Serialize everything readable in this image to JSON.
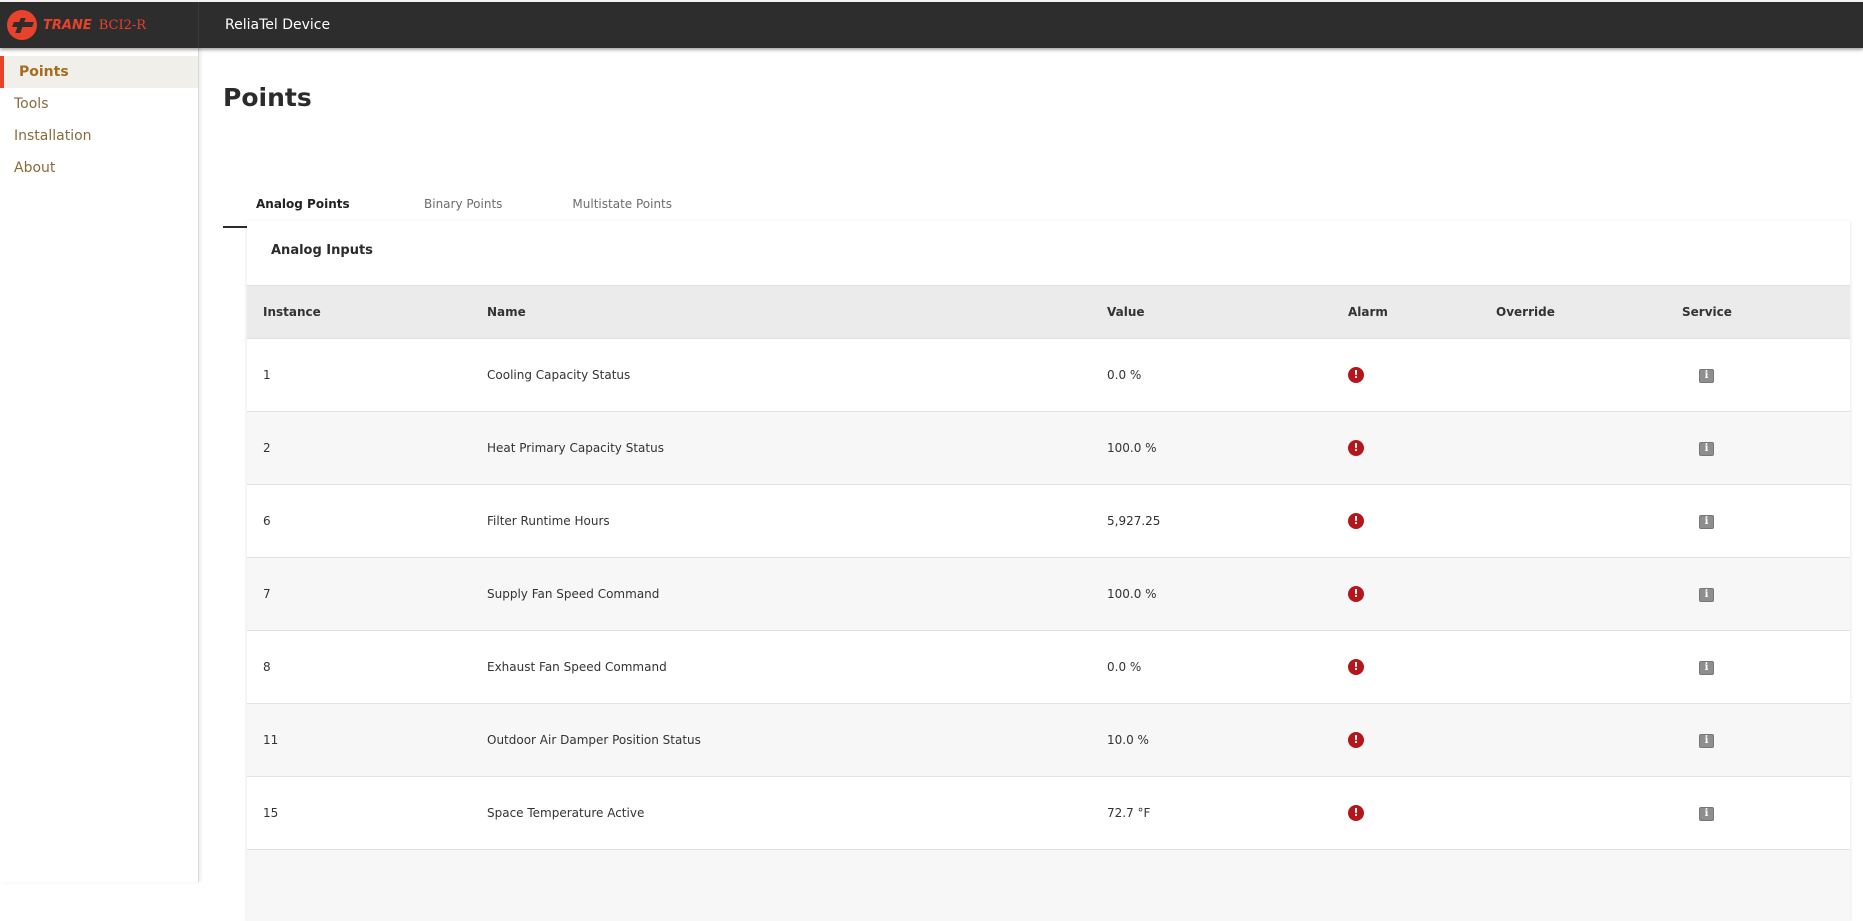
{
  "header": {
    "brand": "TRANE",
    "model": "BCI2-R",
    "device_title": "ReliaTel Device"
  },
  "sidebar": {
    "items": [
      {
        "label": "Points",
        "active": true
      },
      {
        "label": "Tools",
        "active": false
      },
      {
        "label": "Installation",
        "active": false
      },
      {
        "label": "About",
        "active": false
      }
    ]
  },
  "main": {
    "page_title": "Points",
    "tabs": [
      {
        "label": "Analog Points",
        "active": true
      },
      {
        "label": "Binary Points",
        "active": false
      },
      {
        "label": "Multistate Points",
        "active": false
      }
    ],
    "card_title": "Analog Inputs",
    "columns": [
      "Instance",
      "Name",
      "Value",
      "Alarm",
      "Override",
      "Service"
    ],
    "rows": [
      {
        "instance": "1",
        "name": "Cooling Capacity Status",
        "value": "0.0 %",
        "alarm": "alarm-icon",
        "override": "",
        "service": "info-icon"
      },
      {
        "instance": "2",
        "name": "Heat Primary Capacity Status",
        "value": "100.0 %",
        "alarm": "alarm-icon",
        "override": "",
        "service": "info-icon"
      },
      {
        "instance": "6",
        "name": "Filter Runtime Hours",
        "value": "5,927.25",
        "alarm": "alarm-icon",
        "override": "",
        "service": "info-icon"
      },
      {
        "instance": "7",
        "name": "Supply Fan Speed Command",
        "value": "100.0 %",
        "alarm": "alarm-icon",
        "override": "",
        "service": "info-icon"
      },
      {
        "instance": "8",
        "name": "Exhaust Fan Speed Command",
        "value": "0.0 %",
        "alarm": "alarm-icon",
        "override": "",
        "service": "info-icon"
      },
      {
        "instance": "11",
        "name": "Outdoor Air Damper Position Status",
        "value": "10.0 %",
        "alarm": "alarm-icon",
        "override": "",
        "service": "info-icon"
      },
      {
        "instance": "15",
        "name": "Space Temperature Active",
        "value": "72.7 °F",
        "alarm": "alarm-icon",
        "override": "",
        "service": "info-icon"
      }
    ]
  },
  "colors": {
    "accent": "#e8412c",
    "topbar": "#2d2d2d",
    "nav_text": "#8a6a3c",
    "alarm": "#b3171c"
  }
}
